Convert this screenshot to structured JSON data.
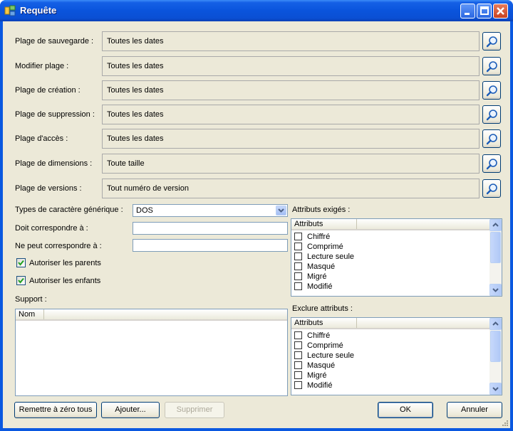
{
  "window": {
    "title": "Requête"
  },
  "criteria": [
    {
      "label": "Plage de sauvegarde :",
      "value": "Toutes les dates"
    },
    {
      "label": "Modifier plage :",
      "value": "Toutes les dates"
    },
    {
      "label": "Plage de création :",
      "value": "Toutes les dates"
    },
    {
      "label": "Plage de suppression :",
      "value": "Toutes les dates"
    },
    {
      "label": "Plage d'accès :",
      "value": "Toutes les dates"
    },
    {
      "label": "Plage de dimensions :",
      "value": "Toute taille"
    },
    {
      "label": "Plage de versions :",
      "value": "Tout numéro de version"
    }
  ],
  "wildcard": {
    "label": "Types de caractère générique :",
    "selected": "DOS"
  },
  "must_match": {
    "label": "Doit correspondre à :",
    "value": ""
  },
  "must_not_match": {
    "label": "Ne peut correspondre à :",
    "value": ""
  },
  "options": {
    "allow_parents": {
      "label": "Autoriser les parents",
      "checked": true
    },
    "allow_children": {
      "label": "Autoriser les enfants",
      "checked": true
    }
  },
  "support": {
    "label": "Support :",
    "column": "Nom"
  },
  "required_attributes": {
    "label": "Attributs exigés :",
    "column": "Attributs",
    "items": [
      "Chiffré",
      "Comprimé",
      "Lecture seule",
      "Masqué",
      "Migré",
      "Modifié"
    ]
  },
  "exclude_attributes": {
    "label": "Exclure attributs :",
    "column": "Attributs",
    "items": [
      "Chiffré",
      "Comprimé",
      "Lecture seule",
      "Masqué",
      "Migré",
      "Modifié"
    ]
  },
  "buttons": {
    "reset_all": "Remettre à zéro tous",
    "add": "Ajouter...",
    "remove": "Supprimer",
    "ok": "OK",
    "cancel": "Annuler"
  },
  "colors": {
    "title_bar": "#0a54dc",
    "dialog_bg": "#ece9d8",
    "field_border": "#7f9db9"
  },
  "icons": {
    "search": "magnifier-icon",
    "app": "app-icon",
    "checkmark": "checkmark-icon"
  }
}
